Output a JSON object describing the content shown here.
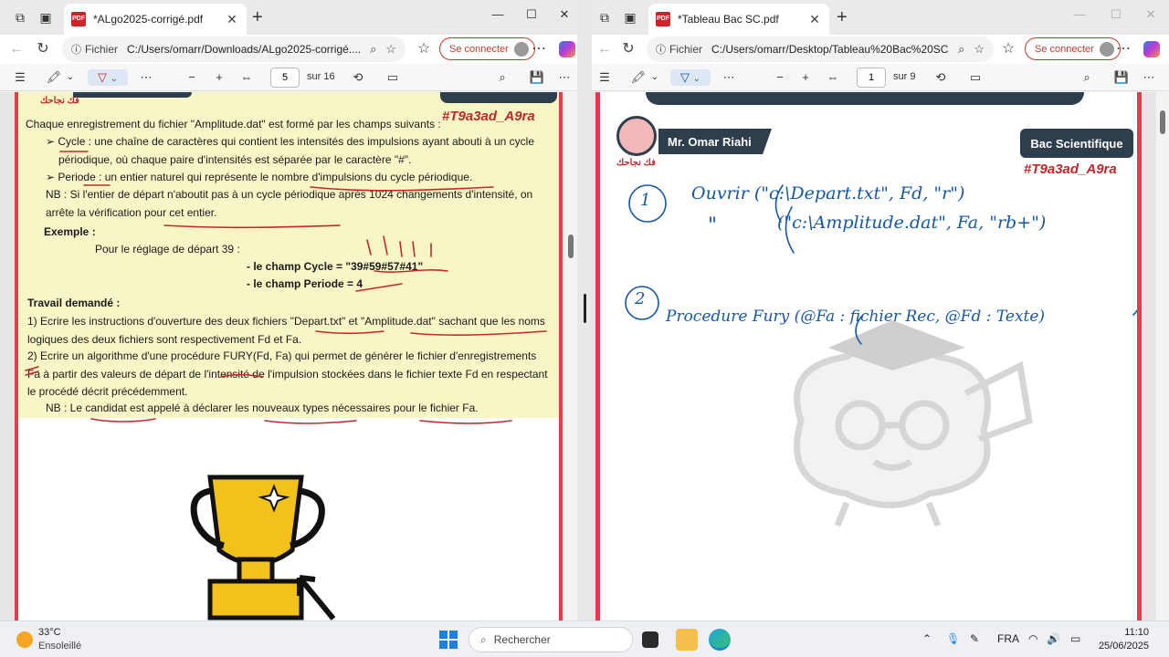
{
  "left_window": {
    "tab_title": "*ALgo2025-corrigé.pdf",
    "fichier_label": "Fichier",
    "url": "C:/Users/omarr/Downloads/ALgo2025-corrigé....",
    "connect_label": "Se connecter",
    "page_current": "5",
    "page_total": "sur 16",
    "zoom_out": "−",
    "zoom_in": "+",
    "document": {
      "hashtag": "#T9a3ad_A9ra",
      "logo_text": "فك نجاحك",
      "intro": "Chaque enregistrement du fichier \"Amplitude.dat\" est formé par les champs suivants :",
      "field_cycle": "Cycle : une chaîne de caractères qui contient les intensités des impulsions ayant abouti à un cycle périodique, où chaque paire d'intensités est séparée par le caractère \"#\".",
      "field_periode": "Periode : un entier naturel qui représente le nombre d'impulsions du cycle périodique.",
      "nb1": "NB : Si l'entier de départ n'aboutit pas à un cycle périodique après 1024 changements d'intensité, on arrête la vérification pour cet entier.",
      "example_title": "Exemple :",
      "example_line": "Pour le réglage de départ 39 :",
      "example_cycle": "-   le champ Cycle = \"39#59#57#41\"",
      "example_periode": "-   le champ Periode = 4",
      "work_title": "Travail demandé :",
      "work_1": "1)  Ecrire les instructions d'ouverture des deux fichiers \"Depart.txt\" et \"Amplitude.dat\" sachant que les noms logiques des deux fichiers sont respectivement Fd et Fa.",
      "work_2": "2)  Ecrire un algorithme d'une procédure FURY(Fd, Fa) qui permet de générer le fichier d'enregistrements Fa à partir des valeurs de départ de l'intensité de l'impulsion stockées dans le fichier texte Fd en respectant le procédé décrit précédemment.",
      "nb2": "NB : Le candidat est appelé à déclarer les nouveaux types nécessaires pour le fichier Fa."
    }
  },
  "right_window": {
    "tab_title": "*Tableau Bac SC.pdf",
    "fichier_label": "Fichier",
    "url": "C:/Users/omarr/Desktop/Tableau%20Bac%20SC....",
    "connect_label": "Se connecter",
    "page_current": "1",
    "page_total": "sur 9",
    "zoom_out": "−",
    "zoom_in": "+",
    "document": {
      "author": "Mr. Omar Riahi",
      "badge": "Bac Scientifique",
      "hashtag": "#T9a3ad_A9ra",
      "logo_text": "فك نجاحك",
      "hw_num1": "1",
      "hw_line1": "Ouvrir (\"c:\\Depart.txt\", Fd, \"r\")",
      "hw_ditto": "\"",
      "hw_line2": "(\"c:\\Amplitude.dat\", Fa, \"rb+\")",
      "hw_num2": "2",
      "hw_line3": "Procedure Fury (@Fa : fichier Rec, @Fd : Texte)"
    }
  },
  "taskbar": {
    "temperature": "33°C",
    "weather": "Ensoleillé",
    "search_placeholder": "Rechercher",
    "lang": "FRA",
    "time": "11:10",
    "date": "25/06/2025"
  }
}
